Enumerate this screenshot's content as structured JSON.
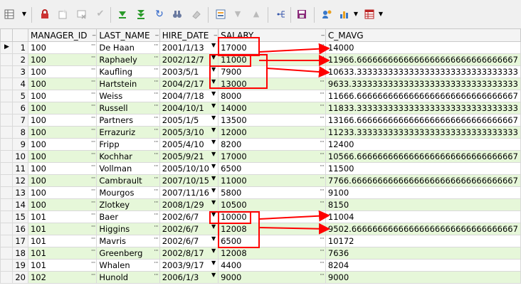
{
  "toolbar": {
    "items": [
      "grid-menu-icon",
      "dropdown-arrow-icon",
      "lock-icon",
      "add-record-icon",
      "delete-record-icon",
      "commit-check-icon",
      "move-down-icon",
      "move-last-icon",
      "refresh-icon",
      "find-binoculars-icon",
      "clear-eraser-icon",
      "form-view-icon",
      "sort-desc-icon",
      "sort-asc-icon",
      "tree-icon",
      "save-icon",
      "user-info-icon",
      "chart-icon",
      "dropdown-arrow-icon",
      "table-icon",
      "dropdown-arrow-icon"
    ]
  },
  "grid": {
    "columns": [
      "MANAGER_ID",
      "LAST_NAME",
      "HIRE_DATE",
      "SALARY",
      "C_MAVG"
    ],
    "rows": [
      {
        "num": "1",
        "manager_id": "100",
        "last_name": "De Haan",
        "hire_date": "2001/1/13",
        "salary": "17000",
        "c_mavg": "14000"
      },
      {
        "num": "2",
        "manager_id": "100",
        "last_name": "Raphaely",
        "hire_date": "2002/12/7",
        "salary": "11000",
        "c_mavg": "11966.6666666666666666666666666666667"
      },
      {
        "num": "3",
        "manager_id": "100",
        "last_name": "Kaufling",
        "hire_date": "2003/5/1",
        "salary": "7900",
        "c_mavg": "10633.3333333333333333333333333333333"
      },
      {
        "num": "4",
        "manager_id": "100",
        "last_name": "Hartstein",
        "hire_date": "2004/2/17",
        "salary": "13000",
        "c_mavg": "9633.33333333333333333333333333333333"
      },
      {
        "num": "5",
        "manager_id": "100",
        "last_name": "Weiss",
        "hire_date": "2004/7/18",
        "salary": "8000",
        "c_mavg": "11666.6666666666666666666666666666667"
      },
      {
        "num": "6",
        "manager_id": "100",
        "last_name": "Russell",
        "hire_date": "2004/10/1",
        "salary": "14000",
        "c_mavg": "11833.3333333333333333333333333333333"
      },
      {
        "num": "7",
        "manager_id": "100",
        "last_name": "Partners",
        "hire_date": "2005/1/5",
        "salary": "13500",
        "c_mavg": "13166.6666666666666666666666666666667"
      },
      {
        "num": "8",
        "manager_id": "100",
        "last_name": "Errazuriz",
        "hire_date": "2005/3/10",
        "salary": "12000",
        "c_mavg": "11233.3333333333333333333333333333333"
      },
      {
        "num": "9",
        "manager_id": "100",
        "last_name": "Fripp",
        "hire_date": "2005/4/10",
        "salary": "8200",
        "c_mavg": "12400"
      },
      {
        "num": "10",
        "manager_id": "100",
        "last_name": "Kochhar",
        "hire_date": "2005/9/21",
        "salary": "17000",
        "c_mavg": "10566.6666666666666666666666666666667"
      },
      {
        "num": "11",
        "manager_id": "100",
        "last_name": "Vollman",
        "hire_date": "2005/10/10",
        "salary": "6500",
        "c_mavg": "11500"
      },
      {
        "num": "12",
        "manager_id": "100",
        "last_name": "Cambrault",
        "hire_date": "2007/10/15",
        "salary": "11000",
        "c_mavg": "7766.66666666666666666666666666666667"
      },
      {
        "num": "13",
        "manager_id": "100",
        "last_name": "Mourgos",
        "hire_date": "2007/11/16",
        "salary": "5800",
        "c_mavg": "9100"
      },
      {
        "num": "14",
        "manager_id": "100",
        "last_name": "Zlotkey",
        "hire_date": "2008/1/29",
        "salary": "10500",
        "c_mavg": "8150"
      },
      {
        "num": "15",
        "manager_id": "101",
        "last_name": "Baer",
        "hire_date": "2002/6/7",
        "salary": "10000",
        "c_mavg": "11004"
      },
      {
        "num": "16",
        "manager_id": "101",
        "last_name": "Higgins",
        "hire_date": "2002/6/7",
        "salary": "12008",
        "c_mavg": "9502.66666666666666666666666666666667"
      },
      {
        "num": "17",
        "manager_id": "101",
        "last_name": "Mavris",
        "hire_date": "2002/6/7",
        "salary": "6500",
        "c_mavg": "10172"
      },
      {
        "num": "18",
        "manager_id": "101",
        "last_name": "Greenberg",
        "hire_date": "2002/8/17",
        "salary": "12008",
        "c_mavg": "7636"
      },
      {
        "num": "19",
        "manager_id": "101",
        "last_name": "Whalen",
        "hire_date": "2003/9/17",
        "salary": "4400",
        "c_mavg": "8204"
      },
      {
        "num": "20",
        "manager_id": "102",
        "last_name": "Hunold",
        "hire_date": "2006/1/3",
        "salary": "9000",
        "c_mavg": "9000"
      }
    ]
  },
  "colors": {
    "row_even": "#e6f7d9",
    "annotation": "#ff0000",
    "header_bg": "#f4f4f4"
  }
}
